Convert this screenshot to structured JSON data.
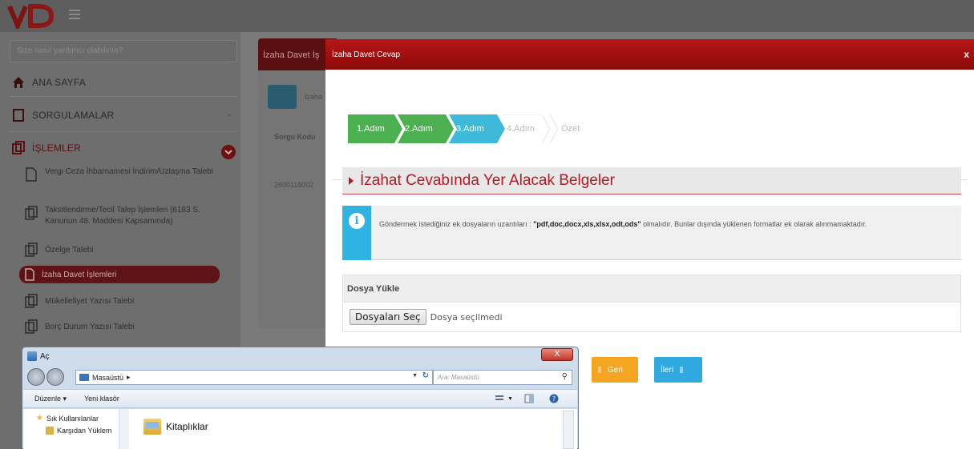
{
  "app": {
    "logo_text": "VD",
    "colors": {
      "brand_red": "#b51a22",
      "wizard_green": "#4caf50",
      "wizard_blue": "#3eb9d9",
      "info_blue": "#2fb3e0",
      "prev_orange": "#f4a623",
      "next_blue": "#2fa9e0"
    }
  },
  "sidebar": {
    "search_placeholder": "Size nasıl yardımcı olabilirim?",
    "home_label": "ANA SAYFA",
    "queries_label": "SORGULAMALAR",
    "operations_label": "İŞLEMLER",
    "sub_items": [
      {
        "label": "Vergi Ceza İhbarnamesi İndirim/Uzlaşma Talebi"
      },
      {
        "label": "Taksitlendirme/Tecil Talep İşlemleri (6183 S. Kanunun 48. Maddesi Kapsamında)"
      },
      {
        "label": "Özelge Talebi"
      },
      {
        "label": "İzaha Davet İşlemleri"
      },
      {
        "label": "Mükellefiyet Yazısı Talebi"
      },
      {
        "label": "Borç Durum Yazısı Talebi"
      }
    ]
  },
  "background_panel": {
    "header": "İzaha Davet İş",
    "info_text": "İzaha",
    "column_header": "Sorgu Kodu",
    "row_value": "2600118002"
  },
  "modal": {
    "title": "İzaha Davet Cevap",
    "close_label": "x",
    "steps": [
      {
        "label": "1.Adım",
        "state": "done"
      },
      {
        "label": "2.Adım",
        "state": "done"
      },
      {
        "label": "3.Adım",
        "state": "active"
      },
      {
        "label": "4.Adım",
        "state": "pending"
      },
      {
        "label": "Özet",
        "state": "pending"
      }
    ],
    "section_title": "İzahat Cevabında Yer Alacak Belgeler",
    "alert_pre": "Göndermek istediğiniz ek dosyaların uzantıları : ",
    "alert_bold": "\"pdf,doc,docx,xls,xlsx,odt,ods\"",
    "alert_post": " olmalıdır. Bunlar dışında yüklenen formatlar ek olarak alınmamaktadır.",
    "upload_title": "Dosya Yükle",
    "file_button": "Dosyaları Seç",
    "file_status": "Dosya seçilmedi",
    "prev_label": "Geri",
    "next_label": "İleri"
  },
  "file_dialog": {
    "title": "Aç",
    "close_label": "X",
    "address": "Masaüstü",
    "address_arrow": "▸",
    "search_placeholder": "Ara: Masaüstü",
    "organize_label": "Düzenle ▾",
    "new_folder_label": "Yeni klasör",
    "tree": [
      {
        "label": "Sık Kullanılanlar"
      },
      {
        "label": "Karşıdan Yüklem"
      }
    ],
    "item": "Kitaplıklar"
  }
}
